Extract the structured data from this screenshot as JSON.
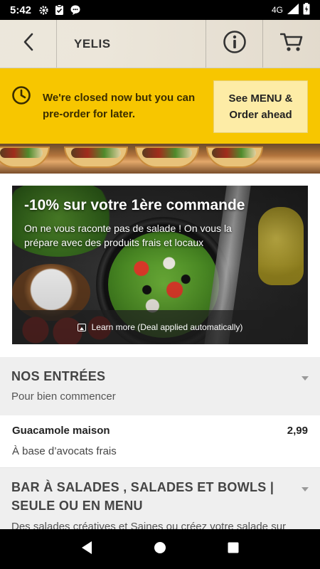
{
  "status_bar": {
    "time": "5:42",
    "network": "4G",
    "icons": [
      "gear-icon",
      "clipboard-check-icon",
      "chat-bubble-icon",
      "signal-icon",
      "battery-icon"
    ]
  },
  "header": {
    "title": "YELIS",
    "icons": [
      "back-arrow-icon",
      "info-icon",
      "cart-icon"
    ]
  },
  "closed_banner": {
    "message": "We're closed now but you can pre-order for later.",
    "cta_label": "See MENU & Order ahead",
    "bg_color": "#f7c600",
    "icon": "clock-icon"
  },
  "promo": {
    "title": "-10% sur votre 1ère commande",
    "subtitle": "On ne vous raconte pas de salade ! On vous la prépare avec des produits frais et locaux",
    "learn_more": "Learn more (Deal applied automatically)",
    "icon": "image-icon"
  },
  "sections": [
    {
      "title": "NOS ENTRÉES",
      "subtitle": "Pour bien commencer"
    },
    {
      "title": "BAR À SALADES , SALADES ET BOWLS | SEULE OU EN MENU",
      "subtitle": "Des salades créatives et Saines ou créez votre salade sur"
    }
  ],
  "items": [
    {
      "name": "Guacamole maison",
      "price": "2,99",
      "description": "À base d’avocats frais"
    }
  ],
  "nav_bar": {
    "icons": [
      "back-triangle-icon",
      "home-circle-icon",
      "recents-square-icon"
    ]
  }
}
